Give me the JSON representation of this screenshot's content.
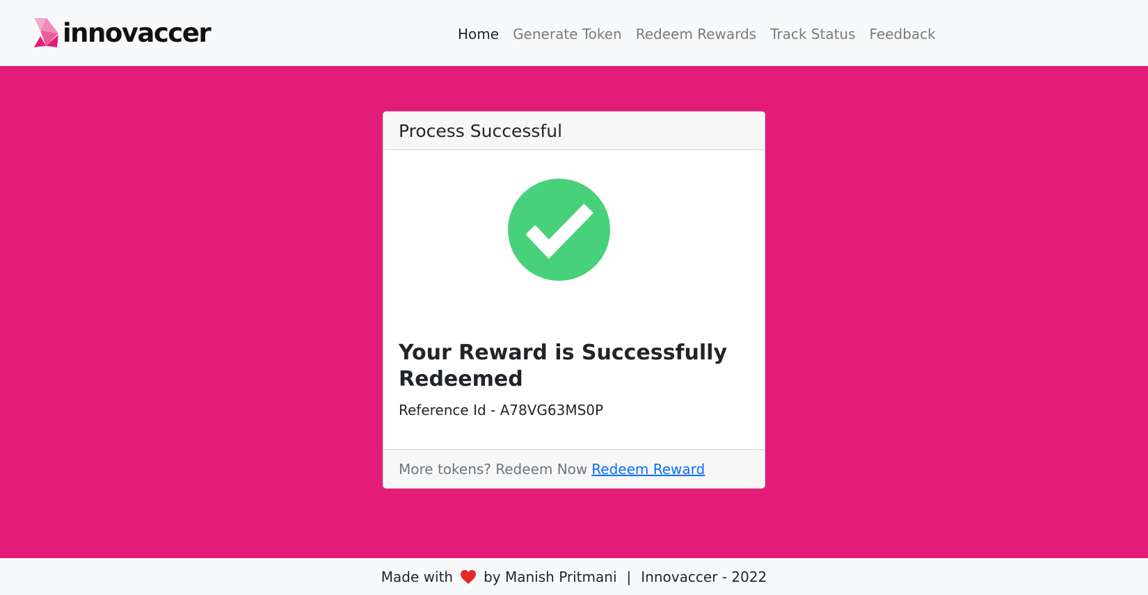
{
  "brand": {
    "name": "innovaccer",
    "logo_colors": [
      "#f6a7c9",
      "#ee5a9c",
      "#e31c79"
    ]
  },
  "nav": {
    "items": [
      {
        "label": "Home",
        "active": true
      },
      {
        "label": "Generate Token",
        "active": false
      },
      {
        "label": "Redeem Rewards",
        "active": false
      },
      {
        "label": "Track Status",
        "active": false
      },
      {
        "label": "Feedback",
        "active": false
      }
    ]
  },
  "main": {
    "background_color": "#e31c79"
  },
  "card": {
    "header": "Process Successful",
    "icon": "check-circle-icon",
    "icon_color": "#48d17b",
    "title": "Your Reward is Successfully Redeemed",
    "reference_text": "Reference Id - A78VG63MS0P",
    "footer_text": "More tokens? Redeem Now",
    "footer_link": "Redeem Reward"
  },
  "footer": {
    "prefix": "Made with",
    "heart_icon": "heart-icon",
    "author": "by Manish Pritmani",
    "separator": "|",
    "org": "Innovaccer - 2022"
  }
}
